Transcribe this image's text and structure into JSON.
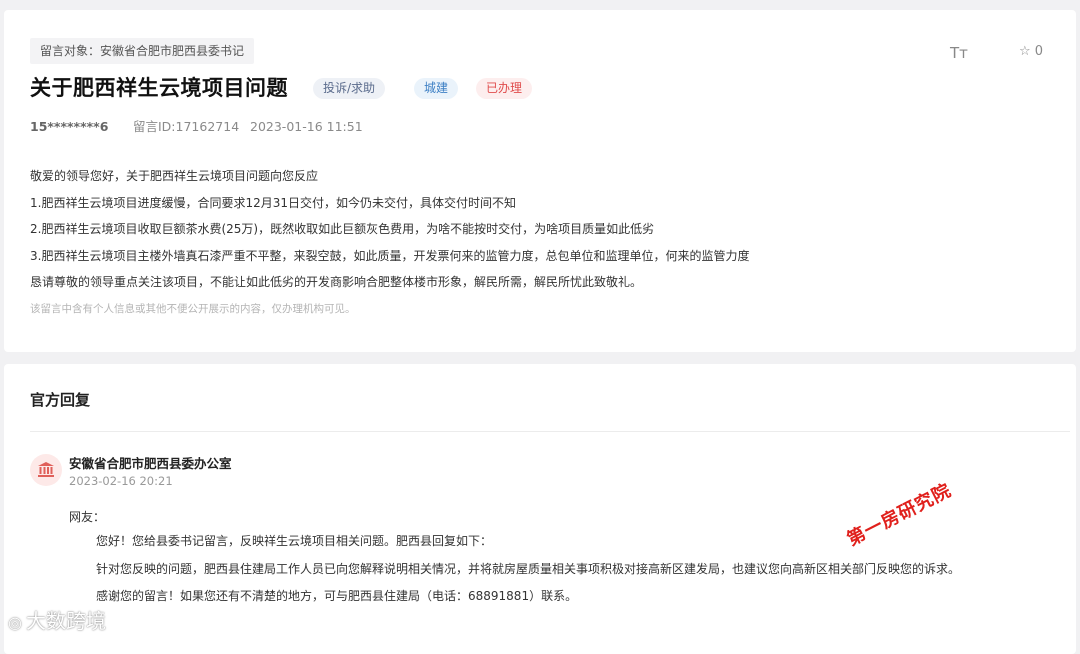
{
  "message": {
    "target": "留言对象：安徽省合肥市肥西县委书记",
    "title": "关于肥西祥生云境项目问题",
    "tags": [
      "投诉/求助",
      "城建",
      "已办理"
    ],
    "user": "15********6",
    "message_id": "留言ID:17162714",
    "date": "2023-01-16 11:51",
    "tools": {
      "font_icon": "Tт",
      "star_icon": "☆",
      "star_count": "0"
    },
    "body": [
      "敬爱的领导您好，关于肥西祥生云境项目问题向您反应",
      "1.肥西祥生云境项目进度缓慢，合同要求12月31日交付，如今仍未交付，具体交付时间不知",
      "2.肥西祥生云境项目收取巨额茶水费(25万)，既然收取如此巨额灰色费用，为啥不能按时交付，为啥项目质量如此低劣",
      "3.肥西祥生云境项目主楼外墙真石漆严重不平整，来裂空鼓，如此质量，开发票何来的监管力度，总包单位和监理单位，何来的监管力度",
      "恳请尊敬的领导重点关注该项目，不能让如此低劣的开发商影响合肥整体楼市形象，解民所需，解民所忧此致敬礼。"
    ],
    "notice": "该留言中含有个人信息或其他不便公开展示的内容，仅办理机构可见。"
  },
  "reply": {
    "section_title": "官方回复",
    "org": "安徽省合肥市肥西县委办公室",
    "date": "2023-02-16 20:21",
    "greeting": "网友：",
    "lines": [
      "您好！您给县委书记留言，反映祥生云境项目相关问题。肥西县回复如下：",
      "针对您反映的问题，肥西县住建局工作人员已向您解释说明相关情况，并将就房屋质量相关事项积极对接高新区建发局，也建议您向高新区相关部门反映您的诉求。",
      "感谢您的留言！如果您还有不清楚的地方，可与肥西县住建局（电话：68891881）联系。"
    ]
  },
  "watermarks": {
    "red_stamp": "第一房研究院",
    "logo": "大数跨境"
  },
  "colors": {
    "status_red": "#e04d4d",
    "type_blue": "#3c7fc4",
    "avatar_red": "#e0605a"
  }
}
